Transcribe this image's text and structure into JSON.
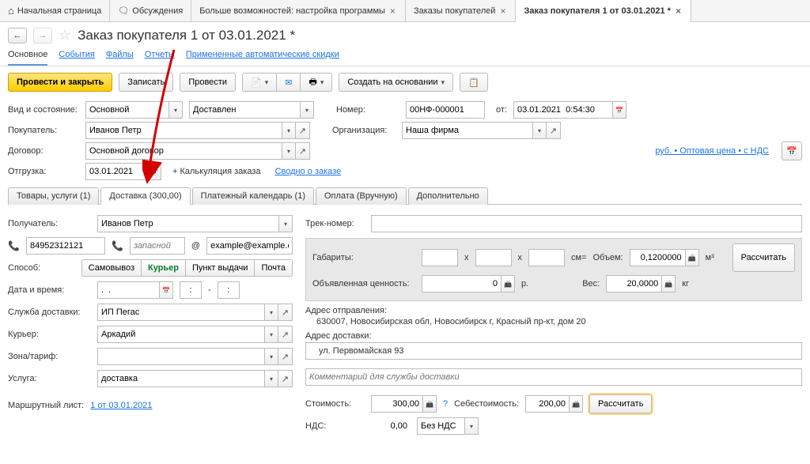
{
  "appTabs": {
    "home": "Начальная страница",
    "discuss": "Обсуждения",
    "more": "Больше возможностей: настройка программы",
    "orders": "Заказы покупателей",
    "order": "Заказ покупателя 1 от 03.01.2021 *"
  },
  "title": "Заказ покупателя 1 от 03.01.2021 *",
  "miniNav": {
    "main": "Основное",
    "events": "События",
    "files": "Файлы",
    "reports": "Отчеты",
    "discounts": "Примененные автоматические скидки"
  },
  "toolbar": {
    "postClose": "Провести и закрыть",
    "save": "Записать",
    "post": "Провести",
    "createBasis": "Создать на основании"
  },
  "form": {
    "typeStateLabel": "Вид и состояние:",
    "type": "Основной",
    "state": "Доставлен",
    "numberLabel": "Номер:",
    "number": "00НФ-000001",
    "fromLabel": "от:",
    "date": "03.01.2021  0:54:30",
    "buyerLabel": "Покупатель:",
    "buyer": "Иванов Петр",
    "orgLabel": "Организация:",
    "org": "Наша фирма",
    "contractLabel": "Договор:",
    "contract": "Основной договор",
    "priceInfo": "руб. • Оптовая цена • с НДС",
    "shipLabel": "Отгрузка:",
    "shipDate": "03.01.2021",
    "calcOrder": "+ Калькуляция заказа",
    "summary": "Сводно о заказе"
  },
  "docTabs": {
    "goods": "Товары, услуги (1)",
    "delivery": "Доставка (300,00)",
    "payCal": "Платежный календарь (1)",
    "payment": "Оплата (Вручную)",
    "extra": "Дополнительно"
  },
  "delivery": {
    "recipientLabel": "Получатель:",
    "recipient": "Иванов Петр",
    "phone1": "84952312121",
    "phone2Placeholder": "запасной",
    "email": "example@example.com",
    "methodLabel": "Способ:",
    "methodPickup": "Самовывоз",
    "methodCourier": "Курьер",
    "methodPoint": "Пункт выдачи",
    "methodPost": "Почта",
    "dateTimeLabel": "Дата и время:",
    "dateVal": ".  .",
    "timeFrom": ":",
    "timeTo": ":",
    "serviceLabel": "Служба доставки:",
    "service": "ИП Пегас",
    "courierLabel": "Курьер:",
    "courier": "Аркадий",
    "zoneLabel": "Зона/тариф:",
    "zone": "",
    "productLabel": "Услуга:",
    "product": "доставка",
    "routeLabel": "Маршрутный лист:",
    "routeLink": "1 от 03.01.2021"
  },
  "right": {
    "trackLabel": "Трек-номер:",
    "dimsLabel": "Габариты:",
    "cmLabel": "см=",
    "volumeLabel": "Объем:",
    "volume": "0,1200000",
    "m3": "м³",
    "declaredLabel": "Объявленная ценность:",
    "declared": "0",
    "rub": "р.",
    "weightLabel": "Вес:",
    "weight": "20,0000",
    "kg": "кг",
    "calcBtn": "Рассчитать",
    "addrFromTitle": "Адрес отправления:",
    "addrFrom": "630007, Новосибирская обл, Новосибирск г, Красный пр-кт, дом 20",
    "addrToTitle": "Адрес доставки:",
    "addrTo": "ул. Первомайская 93",
    "commentPlaceholder": "Комментарий для службы доставки",
    "costLabel": "Стоимость:",
    "cost": "300,00",
    "selfCostLabel": "Себестоимость:",
    "selfCost": "200,00",
    "calcBtn2": "Рассчитать",
    "vatLabel": "НДС:",
    "vat": "0,00",
    "vatType": "Без НДС"
  }
}
